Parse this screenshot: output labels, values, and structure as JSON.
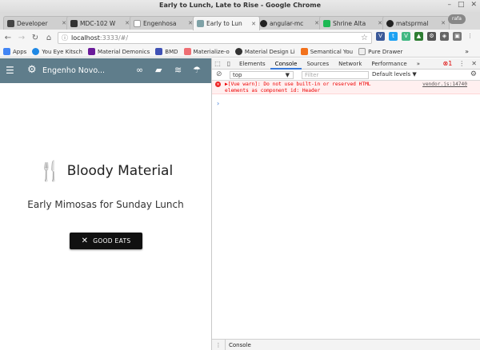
{
  "window": {
    "title": "Early to Lunch, Late to Rise - Google Chrome",
    "controls": [
      "–",
      "□",
      "✕"
    ]
  },
  "tabs": [
    {
      "label": "Developer",
      "color": "#444"
    },
    {
      "label": "MDC-102 W",
      "color": "#333"
    },
    {
      "label": "Engenhosa",
      "color": "#666"
    },
    {
      "label": "Early to Lun",
      "color": "#7fa2a7"
    },
    {
      "label": "angular-mc",
      "color": "#222"
    },
    {
      "label": "Shrine Alta",
      "color": "#1db954"
    },
    {
      "label": "matsprmal",
      "color": "#222"
    }
  ],
  "profile": "rafa",
  "address": {
    "host": "localhost",
    "rest": ":3333/#/"
  },
  "bookmarks": [
    {
      "label": "Apps",
      "color": "#4285f4"
    },
    {
      "label": "You Eye Kitsch",
      "color": "#1e88e5"
    },
    {
      "label": "Material Demonics",
      "color": "#6a1b9a"
    },
    {
      "label": "BMD",
      "color": "#3f51b5"
    },
    {
      "label": "Materialize-o",
      "color": "#ee6e73"
    },
    {
      "label": "Material Design Li",
      "color": "#333"
    },
    {
      "label": "Semantical You",
      "color": "#f2711c"
    },
    {
      "label": "Pure Drawer",
      "color": "#eee"
    }
  ],
  "app": {
    "title": "Engenho Novo...",
    "brand": "Bloody Material",
    "tagline": "Early Mimosas for Sunday Lunch",
    "cta": "GOOD EATS",
    "accent": "#5f7d8b"
  },
  "devtools": {
    "tabs": [
      "Elements",
      "Console",
      "Sources",
      "Network",
      "Performance"
    ],
    "active_tab": "Console",
    "error_count": "1",
    "context": "top",
    "filter_placeholder": "Filter",
    "levels": "Default levels ▼",
    "message": "▶[Vue warn]: Do not use built-in or reserved HTML\nelements as component id: Header",
    "source": "vendor.js:14740",
    "prompt": "›",
    "drawer_tab": "Console"
  }
}
